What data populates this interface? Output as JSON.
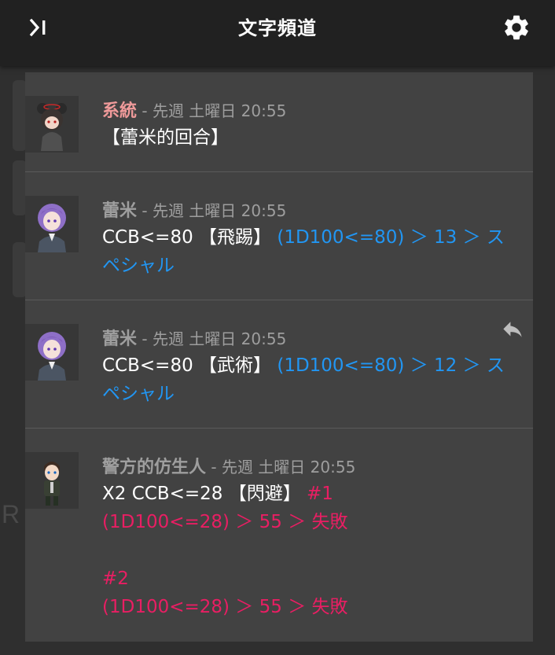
{
  "header": {
    "title": "文字頻道",
    "collapse_icon": "collapse-right-icon",
    "settings_icon": "gear-icon"
  },
  "colors": {
    "system_name": "#ef9a9a",
    "player_name": "#9e9e9e",
    "meta": "#9e9e9e",
    "dice_result": "#2196f3",
    "failure": "#e91e63"
  },
  "messages": [
    {
      "speaker": "系統",
      "meta": " - 先週 土曜日 20:55",
      "avatar": "bear-ears-character-avatar",
      "text": "【蕾米的回合】"
    },
    {
      "speaker": "蕾米",
      "meta": " - 先週 土曜日 20:55",
      "avatar": "purple-hair-girl-avatar",
      "command": "CCB<=80 【飛踢】 ",
      "result": "(1D100<=80) ＞ 13 ＞ スペシャル"
    },
    {
      "speaker": "蕾米",
      "meta": " - 先週 土曜日 20:55",
      "avatar": "purple-hair-girl-avatar",
      "command": "CCB<=80 【武術】 ",
      "result": "(1D100<=80) ＞ 12 ＞ スペシャル",
      "reply_icon": "reply-icon"
    },
    {
      "speaker": "警方的仿生人",
      "meta": " - 先週 土曜日 20:55",
      "avatar": "android-officer-avatar",
      "command": "X2 CCB<=28 【閃避】 ",
      "roll1_label": "#1",
      "roll1_result": "(1D100<=28) ＞ 55 ＞ 失敗",
      "roll2_label": "#2",
      "roll2_result": "(1D100<=28) ＞ 55 ＞ 失敗"
    }
  ]
}
